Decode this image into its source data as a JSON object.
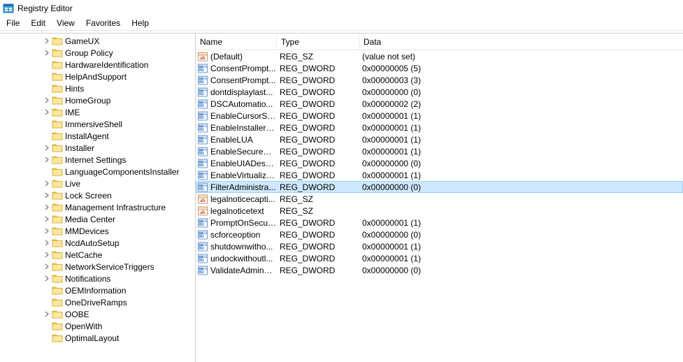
{
  "window": {
    "title": "Registry Editor"
  },
  "menu": [
    "File",
    "Edit",
    "View",
    "Favorites",
    "Help"
  ],
  "tree": [
    {
      "label": "GameUX",
      "depth": 4,
      "expandable": true
    },
    {
      "label": "Group Policy",
      "depth": 4,
      "expandable": true
    },
    {
      "label": "HardwareIdentification",
      "depth": 4,
      "expandable": false
    },
    {
      "label": "HelpAndSupport",
      "depth": 4,
      "expandable": false
    },
    {
      "label": "Hints",
      "depth": 4,
      "expandable": false
    },
    {
      "label": "HomeGroup",
      "depth": 4,
      "expandable": true
    },
    {
      "label": "IME",
      "depth": 4,
      "expandable": true
    },
    {
      "label": "ImmersiveShell",
      "depth": 4,
      "expandable": false
    },
    {
      "label": "InstallAgent",
      "depth": 4,
      "expandable": false
    },
    {
      "label": "Installer",
      "depth": 4,
      "expandable": true
    },
    {
      "label": "Internet Settings",
      "depth": 4,
      "expandable": true
    },
    {
      "label": "LanguageComponentsInstaller",
      "depth": 4,
      "expandable": false
    },
    {
      "label": "Live",
      "depth": 4,
      "expandable": true
    },
    {
      "label": "Lock Screen",
      "depth": 4,
      "expandable": true
    },
    {
      "label": "Management Infrastructure",
      "depth": 4,
      "expandable": true
    },
    {
      "label": "Media Center",
      "depth": 4,
      "expandable": true
    },
    {
      "label": "MMDevices",
      "depth": 4,
      "expandable": true
    },
    {
      "label": "NcdAutoSetup",
      "depth": 4,
      "expandable": true
    },
    {
      "label": "NetCache",
      "depth": 4,
      "expandable": true
    },
    {
      "label": "NetworkServiceTriggers",
      "depth": 4,
      "expandable": true
    },
    {
      "label": "Notifications",
      "depth": 4,
      "expandable": true
    },
    {
      "label": "OEMInformation",
      "depth": 4,
      "expandable": false
    },
    {
      "label": "OneDriveRamps",
      "depth": 4,
      "expandable": false
    },
    {
      "label": "OOBE",
      "depth": 4,
      "expandable": true
    },
    {
      "label": "OpenWith",
      "depth": 4,
      "expandable": false
    },
    {
      "label": "OptimalLayout",
      "depth": 4,
      "expandable": false
    }
  ],
  "list": {
    "columns": {
      "name": "Name",
      "type": "Type",
      "data": "Data"
    },
    "rows": [
      {
        "icon": "sz",
        "name": "(Default)",
        "type": "REG_SZ",
        "data": "(value not set)",
        "sel": false
      },
      {
        "icon": "dw",
        "name": "ConsentPrompt...",
        "type": "REG_DWORD",
        "data": "0x00000005 (5)",
        "sel": false
      },
      {
        "icon": "dw",
        "name": "ConsentPrompt...",
        "type": "REG_DWORD",
        "data": "0x00000003 (3)",
        "sel": false
      },
      {
        "icon": "dw",
        "name": "dontdisplaylast...",
        "type": "REG_DWORD",
        "data": "0x00000000 (0)",
        "sel": false
      },
      {
        "icon": "dw",
        "name": "DSCAutomatio...",
        "type": "REG_DWORD",
        "data": "0x00000002 (2)",
        "sel": false
      },
      {
        "icon": "dw",
        "name": "EnableCursorSu...",
        "type": "REG_DWORD",
        "data": "0x00000001 (1)",
        "sel": false
      },
      {
        "icon": "dw",
        "name": "EnableInstallerD...",
        "type": "REG_DWORD",
        "data": "0x00000001 (1)",
        "sel": false
      },
      {
        "icon": "dw",
        "name": "EnableLUA",
        "type": "REG_DWORD",
        "data": "0x00000001 (1)",
        "sel": false
      },
      {
        "icon": "dw",
        "name": "EnableSecureUI...",
        "type": "REG_DWORD",
        "data": "0x00000001 (1)",
        "sel": false
      },
      {
        "icon": "dw",
        "name": "EnableUIADeskt...",
        "type": "REG_DWORD",
        "data": "0x00000000 (0)",
        "sel": false
      },
      {
        "icon": "dw",
        "name": "EnableVirtualiza...",
        "type": "REG_DWORD",
        "data": "0x00000001 (1)",
        "sel": false
      },
      {
        "icon": "dw",
        "name": "FilterAdministra...",
        "type": "REG_DWORD",
        "data": "0x00000000 (0)",
        "sel": true
      },
      {
        "icon": "sz",
        "name": "legalnoticecapti...",
        "type": "REG_SZ",
        "data": "",
        "sel": false
      },
      {
        "icon": "sz",
        "name": "legalnoticetext",
        "type": "REG_SZ",
        "data": "",
        "sel": false
      },
      {
        "icon": "dw",
        "name": "PromptOnSecur...",
        "type": "REG_DWORD",
        "data": "0x00000001 (1)",
        "sel": false
      },
      {
        "icon": "dw",
        "name": "scforceoption",
        "type": "REG_DWORD",
        "data": "0x00000000 (0)",
        "sel": false
      },
      {
        "icon": "dw",
        "name": "shutdownwitho...",
        "type": "REG_DWORD",
        "data": "0x00000001 (1)",
        "sel": false
      },
      {
        "icon": "dw",
        "name": "undockwithoutl...",
        "type": "REG_DWORD",
        "data": "0x00000001 (1)",
        "sel": false
      },
      {
        "icon": "dw",
        "name": "ValidateAdminC...",
        "type": "REG_DWORD",
        "data": "0x00000000 (0)",
        "sel": false
      }
    ]
  }
}
